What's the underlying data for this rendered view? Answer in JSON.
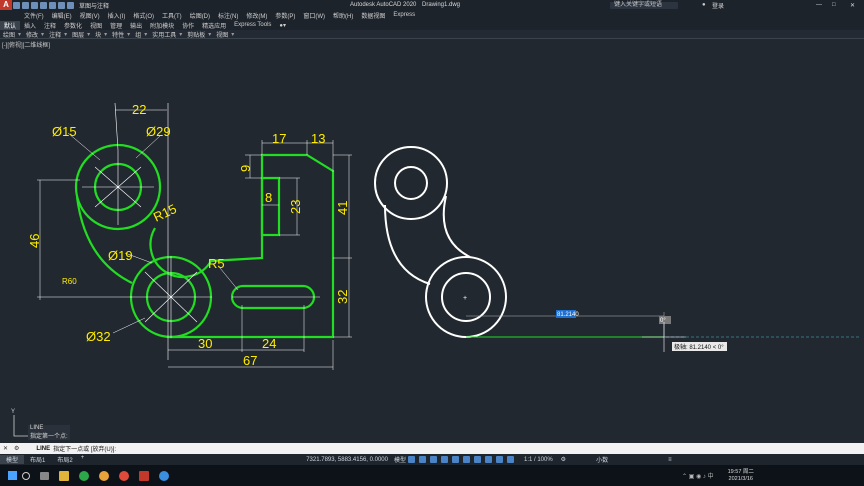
{
  "app": {
    "title": "Autodesk AutoCAD 2020",
    "file": "Drawing1.dwg",
    "workspace": "草图与注释",
    "search_placeholder": "键入关键字或短语",
    "user": "登录"
  },
  "menu": [
    "文件(F)",
    "编辑(E)",
    "视图(V)",
    "插入(I)",
    "格式(O)",
    "工具(T)",
    "绘图(D)",
    "标注(N)",
    "修改(M)",
    "参数(P)",
    "窗口(W)",
    "帮助(H)",
    "数据视图",
    "Express"
  ],
  "ribbon_tabs": [
    "默认",
    "插入",
    "注释",
    "参数化",
    "视图",
    "管理",
    "输出",
    "附加模块",
    "协作",
    "精选应用",
    "Express Tools"
  ],
  "panels": [
    "绘图",
    "修改",
    "注释",
    "图层",
    "块",
    "特性",
    "组",
    "实用工具",
    "剪贴板",
    "视图"
  ],
  "viewport_label": "[-][俯视][二维线框]",
  "dims": {
    "d22": "22",
    "d15": "Ø15",
    "d29": "Ø29",
    "d46": "46",
    "r15": "R15",
    "r60": "R60",
    "d19": "Ø19",
    "r5": "R5",
    "d32a": "Ø32",
    "d30": "30",
    "d24": "24",
    "d67": "67",
    "d17": "17",
    "d13": "13",
    "d9": "9",
    "d8": "8",
    "d23": "23",
    "d41": "41",
    "d32b": "32"
  },
  "dynamic_input": {
    "value": "81.2140",
    "angle": "0°",
    "tooltip": "极轴: 81.2140 < 0°"
  },
  "command": {
    "history_cmd": "LINE",
    "history_prompt": "指定第一个点:",
    "prompt_name": "LINE",
    "prompt": "指定下一点或 [放弃(U)]:"
  },
  "layout_tabs": [
    "模型",
    "布局1",
    "布局2"
  ],
  "status": {
    "coords": "7321.7893, 5883.4156, 0.0000",
    "model": "模型",
    "scale": "1:1 / 100%",
    "units": "小数"
  },
  "clock": {
    "time": "19:57 周二",
    "date": "2021/3/16"
  },
  "colors": {
    "green": "#22dd22",
    "yellow": "#ffee00",
    "white": "#ffffff",
    "cyan_dash": "#4fbfd6",
    "bg": "#212830"
  }
}
